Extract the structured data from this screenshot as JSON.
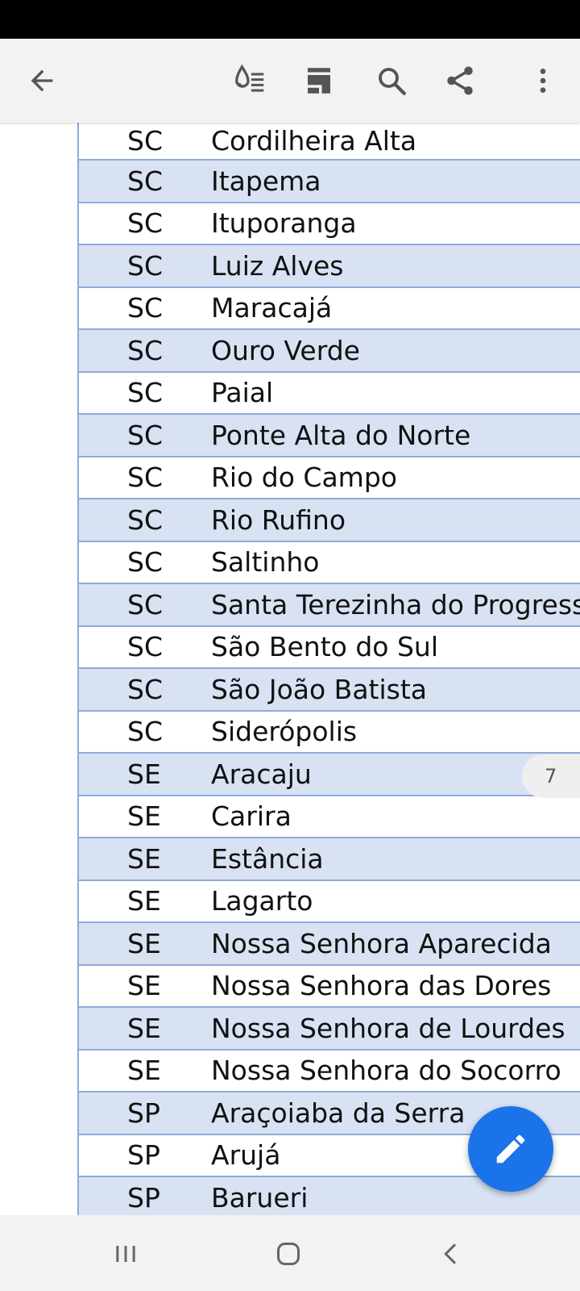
{
  "toolbar": {
    "back_icon": "arrow-left-icon",
    "icons": [
      "text-view-icon",
      "page-layout-icon",
      "search-icon",
      "share-icon",
      "more-vert-icon"
    ]
  },
  "table": {
    "rows": [
      {
        "uf": "SC",
        "city": "Cordilheira Alta"
      },
      {
        "uf": "SC",
        "city": "Itapema"
      },
      {
        "uf": "SC",
        "city": "Ituporanga"
      },
      {
        "uf": "SC",
        "city": "Luiz Alves"
      },
      {
        "uf": "SC",
        "city": "Maracajá"
      },
      {
        "uf": "SC",
        "city": "Ouro Verde"
      },
      {
        "uf": "SC",
        "city": "Paial"
      },
      {
        "uf": "SC",
        "city": "Ponte Alta do Norte"
      },
      {
        "uf": "SC",
        "city": "Rio do Campo"
      },
      {
        "uf": "SC",
        "city": "Rio Rufino"
      },
      {
        "uf": "SC",
        "city": "Saltinho"
      },
      {
        "uf": "SC",
        "city": "Santa Terezinha do Progress"
      },
      {
        "uf": "SC",
        "city": "São Bento do Sul"
      },
      {
        "uf": "SC",
        "city": "São João Batista"
      },
      {
        "uf": "SC",
        "city": "Siderópolis"
      },
      {
        "uf": "SE",
        "city": "Aracaju"
      },
      {
        "uf": "SE",
        "city": "Carira"
      },
      {
        "uf": "SE",
        "city": "Estância"
      },
      {
        "uf": "SE",
        "city": "Lagarto"
      },
      {
        "uf": "SE",
        "city": "Nossa Senhora Aparecida"
      },
      {
        "uf": "SE",
        "city": "Nossa Senhora das Dores"
      },
      {
        "uf": "SE",
        "city": "Nossa Senhora de Lourdes"
      },
      {
        "uf": "SE",
        "city": "Nossa Senhora do Socorro"
      },
      {
        "uf": "SP",
        "city": "Araçoiaba da Serra"
      },
      {
        "uf": "SP",
        "city": "Arujá"
      },
      {
        "uf": "SP",
        "city": "Barueri"
      }
    ]
  },
  "page_indicator": "7",
  "fab": {
    "icon": "edit-pencil-icon"
  },
  "navbar": {
    "icons": [
      "recent-apps-icon",
      "home-icon",
      "back-chevron-icon"
    ]
  },
  "colors": {
    "shaded_row": "#d9e2f3",
    "border": "#8eaadb",
    "fab": "#1a73e8",
    "toolbar_bg": "#f2f2f2"
  }
}
